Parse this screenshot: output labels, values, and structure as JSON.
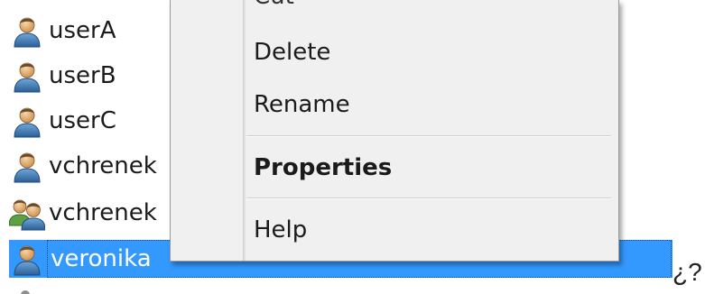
{
  "user_list": {
    "items": [
      {
        "label": "userA",
        "icon": "user-icon"
      },
      {
        "label": "userB",
        "icon": "user-icon"
      },
      {
        "label": "userC",
        "icon": "user-icon"
      },
      {
        "label": "vchrenek",
        "icon": "user-icon"
      },
      {
        "label": "vchrenek",
        "icon": "group-icon"
      },
      {
        "label": "veronika",
        "icon": "user-icon",
        "selected": true
      }
    ]
  },
  "context_menu": {
    "clipped_item": "Cut",
    "items": [
      {
        "label": "Delete"
      },
      {
        "label": "Rename"
      },
      {
        "label": "Properties",
        "bold": true
      },
      {
        "label": "Help"
      }
    ]
  },
  "trailing_text": "¿?",
  "colors": {
    "selection": "#3399ff",
    "menu_background": "#f0f0f0"
  }
}
